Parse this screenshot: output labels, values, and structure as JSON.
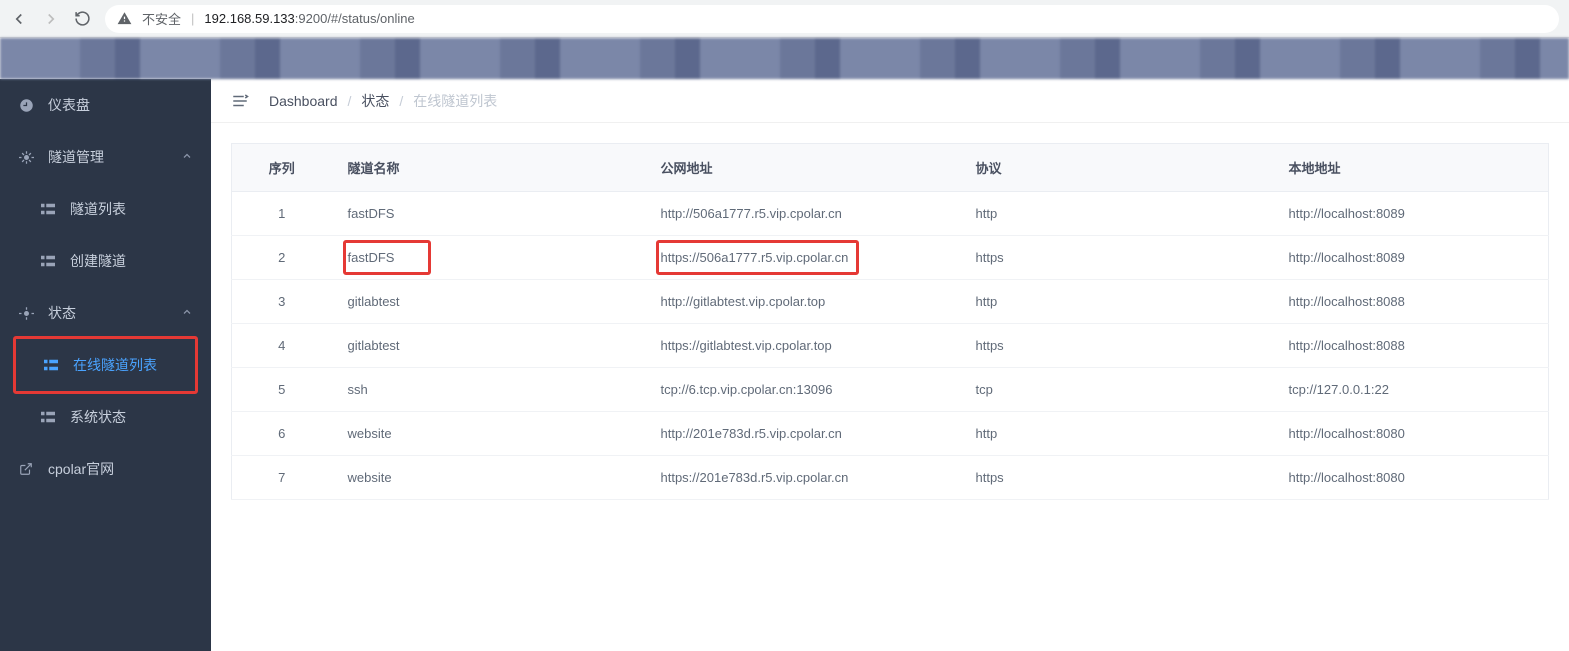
{
  "browser": {
    "insecure_label": "不安全",
    "url_prefix": "192.168.59.133",
    "url_rest": ":9200/#/status/online"
  },
  "sidebar": {
    "items": [
      {
        "label": "仪表盘"
      },
      {
        "label": "隧道管理"
      },
      {
        "label": "隧道列表"
      },
      {
        "label": "创建隧道"
      },
      {
        "label": "状态"
      },
      {
        "label": "在线隧道列表"
      },
      {
        "label": "系统状态"
      },
      {
        "label": "cpolar官网"
      }
    ]
  },
  "breadcrumb": {
    "dashboard": "Dashboard",
    "status": "状态",
    "online": "在线隧道列表"
  },
  "table": {
    "headers": {
      "seq": "序列",
      "name": "隧道名称",
      "url": "公网地址",
      "proto": "协议",
      "local": "本地地址"
    },
    "rows": [
      {
        "seq": "1",
        "name": "fastDFS",
        "url": "http://506a1777.r5.vip.cpolar.cn",
        "proto": "http",
        "local": "http://localhost:8089"
      },
      {
        "seq": "2",
        "name": "fastDFS",
        "url": "https://506a1777.r5.vip.cpolar.cn",
        "proto": "https",
        "local": "http://localhost:8089"
      },
      {
        "seq": "3",
        "name": "gitlabtest",
        "url": "http://gitlabtest.vip.cpolar.top",
        "proto": "http",
        "local": "http://localhost:8088"
      },
      {
        "seq": "4",
        "name": "gitlabtest",
        "url": "https://gitlabtest.vip.cpolar.top",
        "proto": "https",
        "local": "http://localhost:8088"
      },
      {
        "seq": "5",
        "name": "ssh",
        "url": "tcp://6.tcp.vip.cpolar.cn:13096",
        "proto": "tcp",
        "local": "tcp://127.0.0.1:22"
      },
      {
        "seq": "6",
        "name": "website",
        "url": "http://201e783d.r5.vip.cpolar.cn",
        "proto": "http",
        "local": "http://localhost:8080"
      },
      {
        "seq": "7",
        "name": "website",
        "url": "https://201e783d.r5.vip.cpolar.cn",
        "proto": "https",
        "local": "http://localhost:8080"
      }
    ]
  }
}
